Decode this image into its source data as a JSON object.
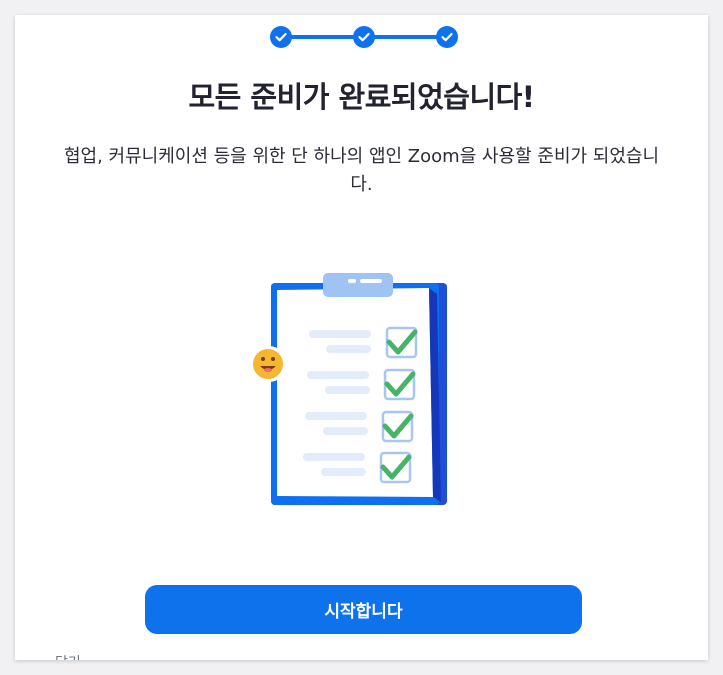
{
  "stepper": {
    "total_steps": 3,
    "completed_steps": 3,
    "accent_color": "#0e72ed"
  },
  "page": {
    "title": "모든 준비가 완료되었습니다!",
    "description": "협업, 커뮤니케이션 등을 위한 단 하나의 앱인 Zoom을 사용할 준비가 되었습니다."
  },
  "illustration": {
    "icon": "clipboard-checklist-icon",
    "checked_items": 4,
    "sticker_icon": "smiley-face-icon"
  },
  "actions": {
    "start_label": "시작합니다"
  },
  "footer": {
    "cutoff_label": "닫기"
  }
}
